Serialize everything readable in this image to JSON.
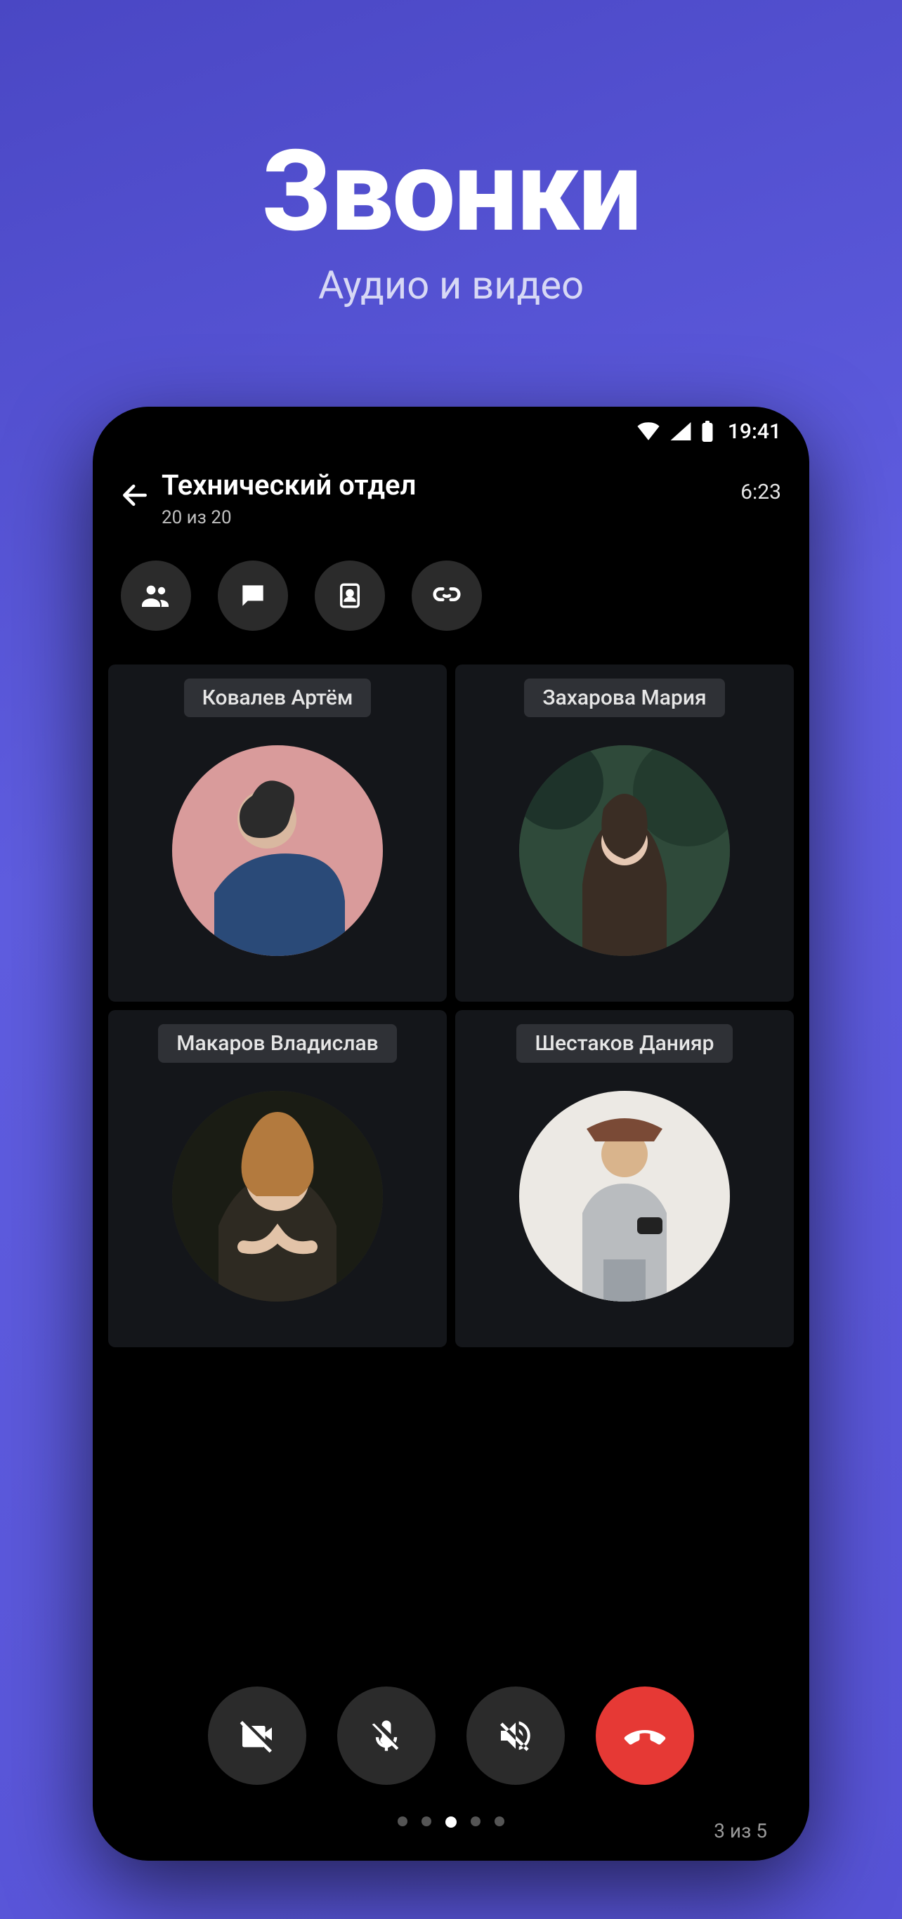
{
  "hero": {
    "title": "Звонки",
    "subtitle": "Аудио и видео"
  },
  "status": {
    "time": "19:41"
  },
  "header": {
    "title": "Технический отдел",
    "subtitle": "20 из 20",
    "duration": "6:23"
  },
  "participants": [
    {
      "name": "Ковалев Артём"
    },
    {
      "name": "Захарова Мария"
    },
    {
      "name": "Макаров Владислав"
    },
    {
      "name": "Шестаков Данияр"
    }
  ],
  "pager": {
    "label": "3 из 5",
    "active_index": 2,
    "total": 5
  }
}
